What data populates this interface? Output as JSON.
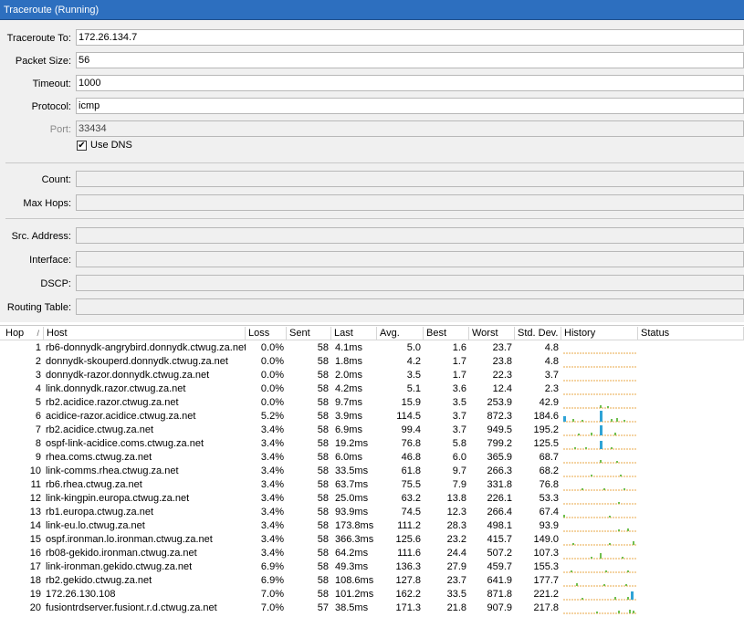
{
  "window": {
    "title": "Traceroute (Running)"
  },
  "form": {
    "traceroute_to": {
      "label": "Traceroute To:",
      "value": "172.26.134.7"
    },
    "packet_size": {
      "label": "Packet Size:",
      "value": "56"
    },
    "timeout": {
      "label": "Timeout:",
      "value": "1000"
    },
    "protocol": {
      "label": "Protocol:",
      "value": "icmp"
    },
    "port": {
      "label": "Port:",
      "value": "33434"
    },
    "use_dns": {
      "label": "Use DNS",
      "checked": true
    },
    "count": {
      "label": "Count:",
      "value": ""
    },
    "max_hops": {
      "label": "Max Hops:",
      "value": ""
    },
    "src_address": {
      "label": "Src. Address:",
      "value": ""
    },
    "interface": {
      "label": "Interface:",
      "value": ""
    },
    "dscp": {
      "label": "DSCP:",
      "value": ""
    },
    "routing_table": {
      "label": "Routing Table:",
      "value": ""
    }
  },
  "table": {
    "columns": [
      "Hop",
      "Host",
      "Loss",
      "Sent",
      "Last",
      "Avg.",
      "Best",
      "Worst",
      "Std. Dev.",
      "History",
      "Status"
    ],
    "sort_indicator": "/",
    "colors": {
      "history_baseline": "#e8a84a",
      "history_bar_blue": "#2fa3d6",
      "history_bar_green": "#6fbf4f"
    },
    "rows": [
      {
        "hop": "1",
        "host": "rb6-donnydk-angrybird.donnydk.ctwug.za.net",
        "loss": "0.0%",
        "sent": "58",
        "last": "4.1ms",
        "avg": "5.0",
        "best": "1.6",
        "worst": "23.7",
        "std": "4.8",
        "spikes": []
      },
      {
        "hop": "2",
        "host": "donnydk-skouperd.donnydk.ctwug.za.net",
        "loss": "0.0%",
        "sent": "58",
        "last": "1.8ms",
        "avg": "4.2",
        "best": "1.7",
        "worst": "23.8",
        "std": "4.8",
        "spikes": []
      },
      {
        "hop": "3",
        "host": "donnydk-razor.donnydk.ctwug.za.net",
        "loss": "0.0%",
        "sent": "58",
        "last": "2.0ms",
        "avg": "3.5",
        "best": "1.7",
        "worst": "22.3",
        "std": "3.7",
        "spikes": []
      },
      {
        "hop": "4",
        "host": "link.donnydk.razor.ctwug.za.net",
        "loss": "0.0%",
        "sent": "58",
        "last": "4.2ms",
        "avg": "5.1",
        "best": "3.6",
        "worst": "12.4",
        "std": "2.3",
        "spikes": []
      },
      {
        "hop": "5",
        "host": "rb2.acidice.razor.ctwug.za.net",
        "loss": "0.0%",
        "sent": "58",
        "last": "9.7ms",
        "avg": "15.9",
        "best": "3.5",
        "worst": "253.9",
        "std": "42.9",
        "spikes": [
          [
            40,
            3,
            "g"
          ],
          [
            48,
            2,
            "g"
          ]
        ]
      },
      {
        "hop": "6",
        "host": "acidice-razor.acidice.ctwug.za.net",
        "loss": "5.2%",
        "sent": "58",
        "last": "3.9ms",
        "avg": "114.5",
        "best": "3.7",
        "worst": "872.3",
        "std": "184.6",
        "spikes": [
          [
            0,
            6,
            "b"
          ],
          [
            10,
            3,
            "g"
          ],
          [
            20,
            2,
            "g"
          ],
          [
            40,
            12,
            "b"
          ],
          [
            52,
            3,
            "g"
          ],
          [
            58,
            4,
            "g"
          ],
          [
            66,
            2,
            "g"
          ]
        ]
      },
      {
        "hop": "7",
        "host": "rb2.acidice.ctwug.za.net",
        "loss": "3.4%",
        "sent": "58",
        "last": "6.9ms",
        "avg": "99.4",
        "best": "3.7",
        "worst": "949.5",
        "std": "195.2",
        "spikes": [
          [
            16,
            2,
            "g"
          ],
          [
            30,
            3,
            "g"
          ],
          [
            40,
            11,
            "b"
          ],
          [
            56,
            3,
            "g"
          ]
        ]
      },
      {
        "hop": "8",
        "host": "ospf-link-acidice.coms.ctwug.za.net",
        "loss": "3.4%",
        "sent": "58",
        "last": "19.2ms",
        "avg": "76.8",
        "best": "5.8",
        "worst": "799.2",
        "std": "125.5",
        "spikes": [
          [
            12,
            2,
            "g"
          ],
          [
            24,
            2,
            "g"
          ],
          [
            40,
            9,
            "b"
          ],
          [
            52,
            2,
            "g"
          ]
        ]
      },
      {
        "hop": "9",
        "host": "rhea.coms.ctwug.za.net",
        "loss": "3.4%",
        "sent": "58",
        "last": "6.0ms",
        "avg": "46.8",
        "best": "6.0",
        "worst": "365.9",
        "std": "68.7",
        "spikes": [
          [
            40,
            3,
            "g"
          ],
          [
            58,
            2,
            "g"
          ]
        ]
      },
      {
        "hop": "10",
        "host": "link-comms.rhea.ctwug.za.net",
        "loss": "3.4%",
        "sent": "58",
        "last": "33.5ms",
        "avg": "61.8",
        "best": "9.7",
        "worst": "266.3",
        "std": "68.2",
        "spikes": [
          [
            30,
            2,
            "g"
          ],
          [
            62,
            2,
            "g"
          ]
        ]
      },
      {
        "hop": "11",
        "host": "rb6.rhea.ctwug.za.net",
        "loss": "3.4%",
        "sent": "58",
        "last": "63.7ms",
        "avg": "75.5",
        "best": "7.9",
        "worst": "331.8",
        "std": "76.8",
        "spikes": [
          [
            20,
            2,
            "g"
          ],
          [
            44,
            2,
            "g"
          ],
          [
            66,
            2,
            "g"
          ]
        ]
      },
      {
        "hop": "12",
        "host": "link-kingpin.europa.ctwug.za.net",
        "loss": "3.4%",
        "sent": "58",
        "last": "25.0ms",
        "avg": "63.2",
        "best": "13.8",
        "worst": "226.1",
        "std": "53.3",
        "spikes": [
          [
            60,
            2,
            "g"
          ]
        ]
      },
      {
        "hop": "13",
        "host": "rb1.europa.ctwug.za.net",
        "loss": "3.4%",
        "sent": "58",
        "last": "93.9ms",
        "avg": "74.5",
        "best": "12.3",
        "worst": "266.4",
        "std": "67.4",
        "spikes": [
          [
            0,
            3,
            "g"
          ],
          [
            50,
            2,
            "g"
          ]
        ]
      },
      {
        "hop": "14",
        "host": "link-eu.lo.ctwug.za.net",
        "loss": "3.4%",
        "sent": "58",
        "last": "173.8ms",
        "avg": "111.2",
        "best": "28.3",
        "worst": "498.1",
        "std": "93.9",
        "spikes": [
          [
            60,
            2,
            "g"
          ],
          [
            70,
            3,
            "g"
          ]
        ]
      },
      {
        "hop": "15",
        "host": "ospf.ironman.lo.ironman.ctwug.za.net",
        "loss": "3.4%",
        "sent": "58",
        "last": "366.3ms",
        "avg": "125.6",
        "best": "23.2",
        "worst": "415.7",
        "std": "149.0",
        "spikes": [
          [
            10,
            2,
            "g"
          ],
          [
            50,
            2,
            "g"
          ],
          [
            76,
            4,
            "g"
          ]
        ]
      },
      {
        "hop": "16",
        "host": "rb08-gekido.ironman.ctwug.za.net",
        "loss": "3.4%",
        "sent": "58",
        "last": "64.2ms",
        "avg": "111.6",
        "best": "24.4",
        "worst": "507.2",
        "std": "107.3",
        "spikes": [
          [
            30,
            2,
            "g"
          ],
          [
            40,
            6,
            "g"
          ],
          [
            64,
            2,
            "g"
          ]
        ]
      },
      {
        "hop": "17",
        "host": "link-ironman.gekido.ctwug.za.net",
        "loss": "6.9%",
        "sent": "58",
        "last": "49.3ms",
        "avg": "136.3",
        "best": "27.9",
        "worst": "459.7",
        "std": "155.3",
        "spikes": [
          [
            8,
            2,
            "g"
          ],
          [
            46,
            2,
            "g"
          ],
          [
            70,
            2,
            "g"
          ]
        ]
      },
      {
        "hop": "18",
        "host": "rb2.gekido.ctwug.za.net",
        "loss": "6.9%",
        "sent": "58",
        "last": "108.6ms",
        "avg": "127.8",
        "best": "23.7",
        "worst": "641.9",
        "std": "177.7",
        "spikes": [
          [
            14,
            3,
            "g"
          ],
          [
            44,
            2,
            "g"
          ],
          [
            68,
            2,
            "g"
          ]
        ]
      },
      {
        "hop": "19",
        "host": "172.26.130.108",
        "loss": "7.0%",
        "sent": "58",
        "last": "101.2ms",
        "avg": "162.2",
        "best": "33.5",
        "worst": "871.8",
        "std": "221.2",
        "spikes": [
          [
            20,
            2,
            "g"
          ],
          [
            56,
            3,
            "g"
          ],
          [
            70,
            3,
            "g"
          ],
          [
            74,
            9,
            "b"
          ]
        ]
      },
      {
        "hop": "20",
        "host": "fusiontrdserver.fusiont.r.d.ctwug.za.net",
        "loss": "7.0%",
        "sent": "57",
        "last": "38.5ms",
        "avg": "171.3",
        "best": "21.8",
        "worst": "907.9",
        "std": "217.8",
        "spikes": [
          [
            36,
            2,
            "g"
          ],
          [
            60,
            3,
            "g"
          ],
          [
            72,
            4,
            "g"
          ],
          [
            76,
            3,
            "g"
          ]
        ]
      }
    ]
  }
}
